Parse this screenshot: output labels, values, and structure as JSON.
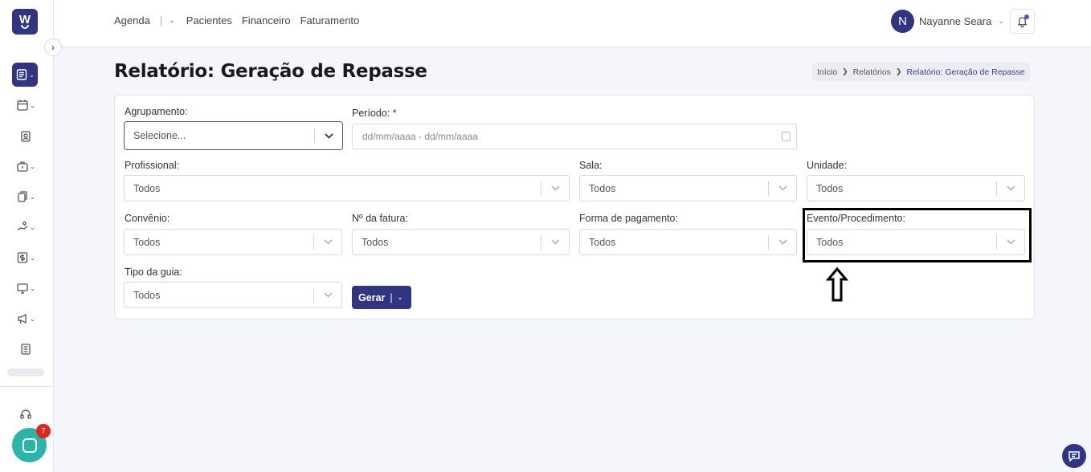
{
  "app": {
    "logo_letter": "W",
    "brand_color": "#2f3580",
    "accent_color": "#2bb5a8"
  },
  "topnav": {
    "items": [
      "Agenda",
      "Pacientes",
      "Financeiro",
      "Faturamento"
    ]
  },
  "user": {
    "initial": "N",
    "name": "Nayanne Seara"
  },
  "page": {
    "title": "Relatório: Geração de Repasse"
  },
  "breadcrumb": {
    "items": [
      "Início",
      "Relatórios",
      "Relatório: Geração de Repasse"
    ]
  },
  "form": {
    "agrupamento": {
      "label": "Agrupamento:",
      "value": "Selecione..."
    },
    "periodo": {
      "label": "Período: *",
      "placeholder": "dd/mm/aaaa - dd/mm/aaaa"
    },
    "profissional": {
      "label": "Profissional:",
      "value": "Todos"
    },
    "sala": {
      "label": "Sala:",
      "value": "Todos"
    },
    "unidade": {
      "label": "Unidade:",
      "value": "Todos"
    },
    "convenio": {
      "label": "Convênio:",
      "value": "Todos"
    },
    "fatura": {
      "label": "Nº da fatura:",
      "value": "Todos"
    },
    "forma_pagamento": {
      "label": "Forma de pagamento:",
      "value": "Todos"
    },
    "evento": {
      "label": "Evento/Procedimento:",
      "value": "Todos"
    },
    "tipo_guia": {
      "label": "Tipo da guia:",
      "value": "Todos"
    },
    "gerar_label": "Gerar"
  },
  "chat": {
    "badge_count": "7"
  }
}
